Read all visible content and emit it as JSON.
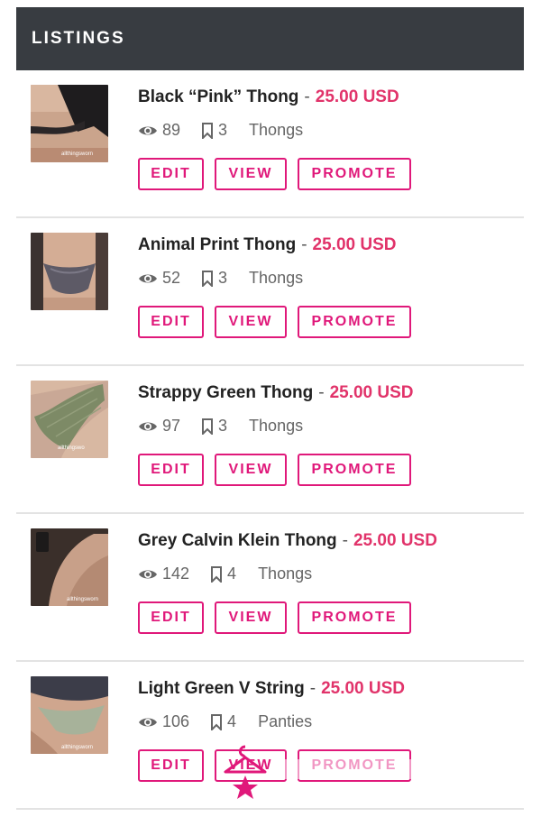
{
  "header": {
    "title": "LISTINGS"
  },
  "colors": {
    "header_bg": "#383c41",
    "price": "#e1336a",
    "button": "#e0187a"
  },
  "listings": [
    {
      "title": "Black “Pink” Thong",
      "separator": "-",
      "price": "25.00 USD",
      "views": "89",
      "saves": "3",
      "category": "Thongs",
      "watermark": "allthingsworn",
      "thumb_icon": "black-thong-photo"
    },
    {
      "title": "Animal Print Thong",
      "separator": "-",
      "price": "25.00 USD",
      "views": "52",
      "saves": "3",
      "category": "Thongs",
      "watermark": "",
      "thumb_icon": "animal-print-thong-photo"
    },
    {
      "title": "Strappy Green Thong",
      "separator": "-",
      "price": "25.00 USD",
      "views": "97",
      "saves": "3",
      "category": "Thongs",
      "watermark": "allthingswo",
      "thumb_icon": "green-thong-photo"
    },
    {
      "title": "Grey Calvin Klein Thong",
      "separator": "-",
      "price": "25.00 USD",
      "views": "142",
      "saves": "4",
      "category": "Thongs",
      "watermark": "allthingsworn",
      "thumb_icon": "grey-thong-photo"
    },
    {
      "title": "Light Green V String",
      "separator": "-",
      "price": "25.00 USD",
      "views": "106",
      "saves": "4",
      "category": "Panties",
      "watermark": "allthingsworn",
      "thumb_icon": "v-string-photo"
    }
  ],
  "buttons": {
    "edit": "EDIT",
    "view": "VIEW",
    "promote": "PROMOTE"
  }
}
